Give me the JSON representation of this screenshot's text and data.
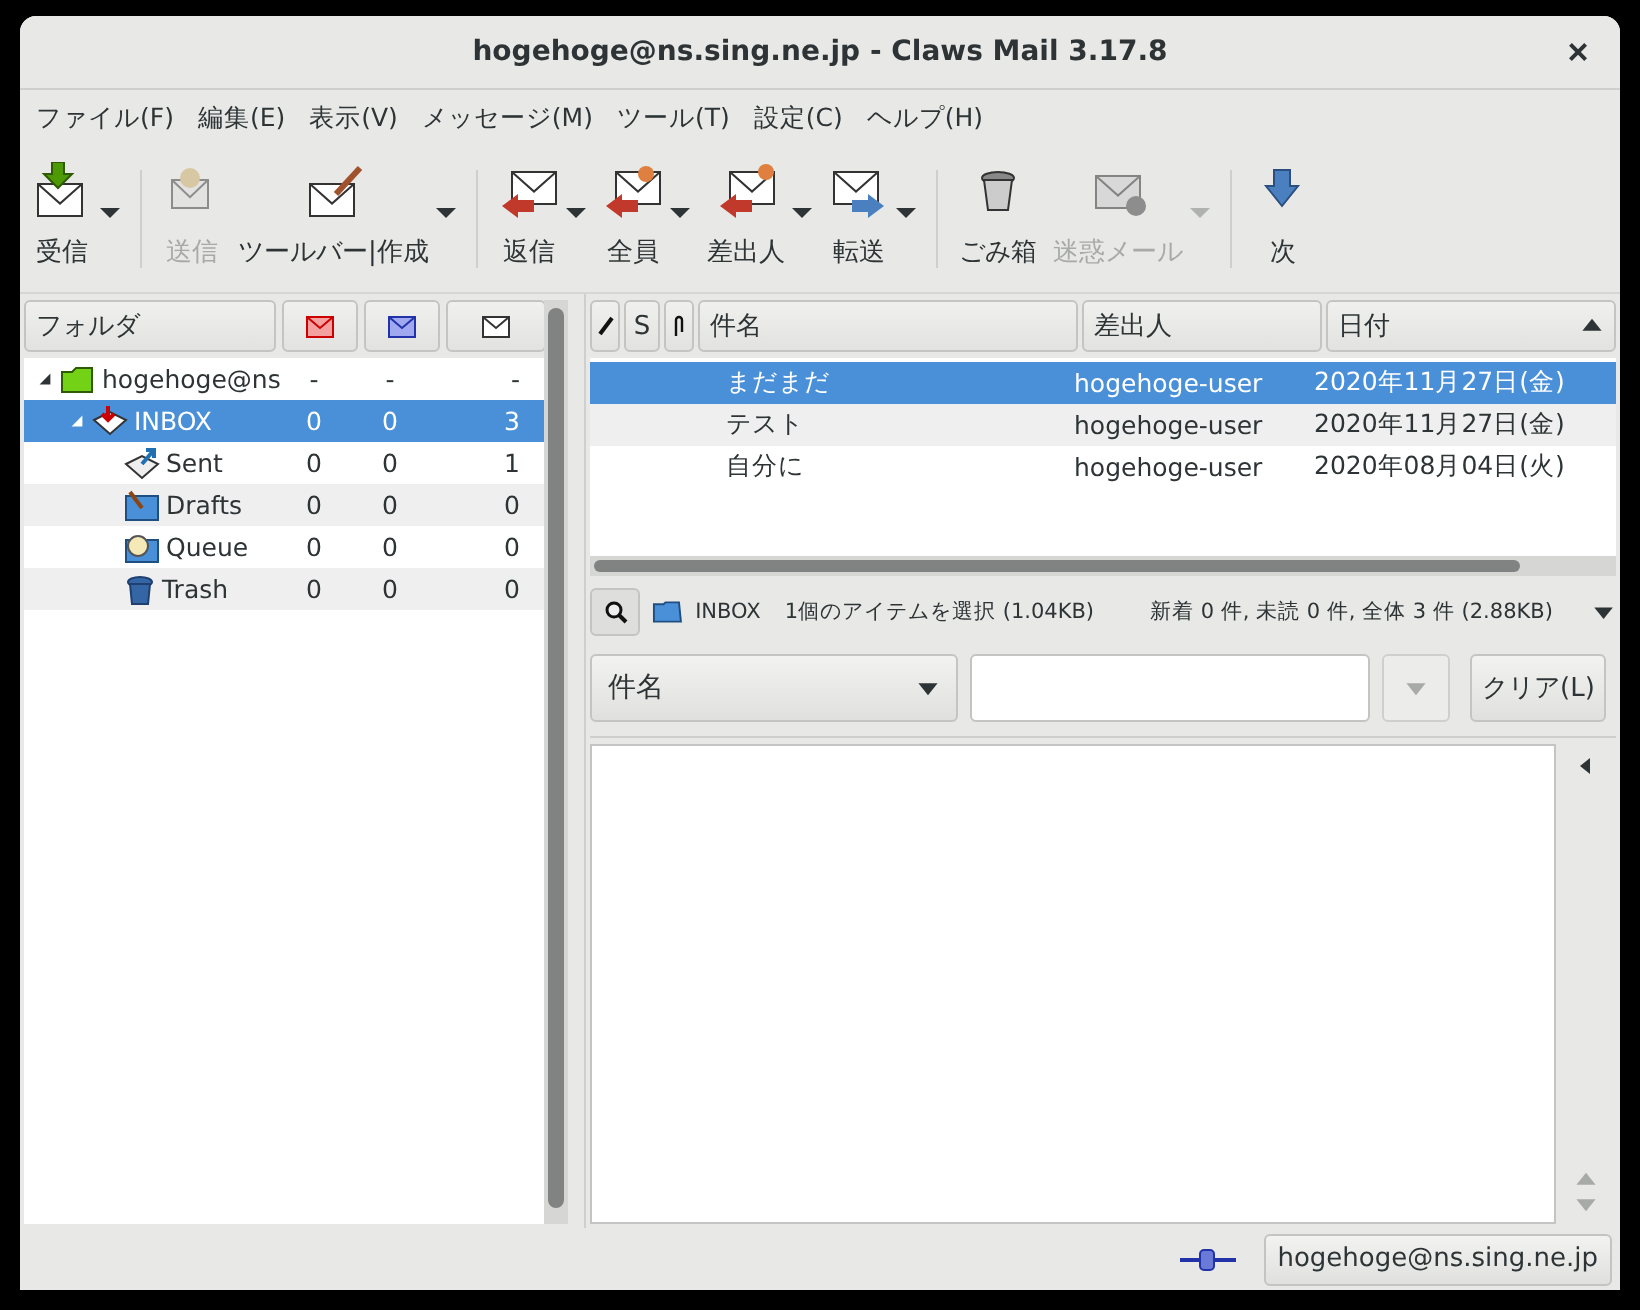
{
  "window": {
    "title": "hogehoge@ns.sing.ne.jp - Claws Mail 3.17.8",
    "close": "×"
  },
  "menu": [
    "ファイル(F)",
    "編集(E)",
    "表示(V)",
    "メッセージ(M)",
    "ツール(T)",
    "設定(C)",
    "ヘルプ(H)"
  ],
  "toolbar": [
    {
      "kind": "button",
      "label": "受信",
      "disabled": false,
      "menu": true
    },
    {
      "kind": "separator"
    },
    {
      "kind": "button",
      "label": "送信",
      "disabled": true,
      "menu": false
    },
    {
      "kind": "button",
      "label": "ツールバー|作成",
      "disabled": false,
      "menu": true
    },
    {
      "kind": "separator"
    },
    {
      "kind": "button",
      "label": "返信",
      "disabled": false,
      "menu": true
    },
    {
      "kind": "button",
      "label": "全員",
      "disabled": false,
      "menu": true
    },
    {
      "kind": "button",
      "label": "差出人",
      "disabled": false,
      "menu": true
    },
    {
      "kind": "button",
      "label": "転送",
      "disabled": false,
      "menu": true
    },
    {
      "kind": "separator"
    },
    {
      "kind": "button",
      "label": "ごみ箱",
      "disabled": false,
      "menu": false
    },
    {
      "kind": "button",
      "label": "迷惑メール",
      "disabled": true,
      "menu": true
    },
    {
      "kind": "separator"
    },
    {
      "kind": "button",
      "label": "次",
      "disabled": false,
      "menu": false
    }
  ],
  "folder_pane": {
    "columns": [
      "フォルダ"
    ],
    "folders": [
      {
        "name": "hogehoge@ns",
        "new": "-",
        "unread": "-",
        "total": "-",
        "expanded": true,
        "selected": false,
        "children": [
          {
            "name": "INBOX",
            "new": "0",
            "unread": "0",
            "total": "3",
            "expanded": true,
            "selected": true,
            "children": [
              {
                "name": "Sent",
                "new": "0",
                "unread": "0",
                "total": "1",
                "selected": false
              },
              {
                "name": "Drafts",
                "new": "0",
                "unread": "0",
                "total": "0",
                "selected": false
              },
              {
                "name": "Queue",
                "new": "0",
                "unread": "0",
                "total": "0",
                "selected": false
              },
              {
                "name": "Trash",
                "new": "0",
                "unread": "0",
                "total": "0",
                "selected": false
              }
            ]
          }
        ]
      }
    ]
  },
  "message_list": {
    "columns": [
      {
        "label": "S"
      },
      {
        "label": "件名"
      },
      {
        "label": "差出人"
      },
      {
        "label": "日付",
        "sorted": true
      }
    ],
    "rows": [
      {
        "subject": "まだまだ",
        "from": "hogehoge-user",
        "date": "2020年11月27日(金)",
        "selected": true
      },
      {
        "subject": "テスト",
        "from": "hogehoge-user",
        "date": "2020年11月27日(金)",
        "selected": false
      },
      {
        "subject": "自分に",
        "from": "hogehoge-user",
        "date": "2020年08月04日(火)",
        "selected": false
      }
    ]
  },
  "info_bar": {
    "folder": "INBOX",
    "selection": "1個のアイテムを選択 (1.04KB)",
    "totals": "新着 0 件, 未読 0 件, 全体 3 件 (2.88KB)"
  },
  "search": {
    "field": "件名",
    "clear": "クリア(L)"
  },
  "status_bar": {
    "account": "hogehoge@ns.sing.ne.jp"
  }
}
